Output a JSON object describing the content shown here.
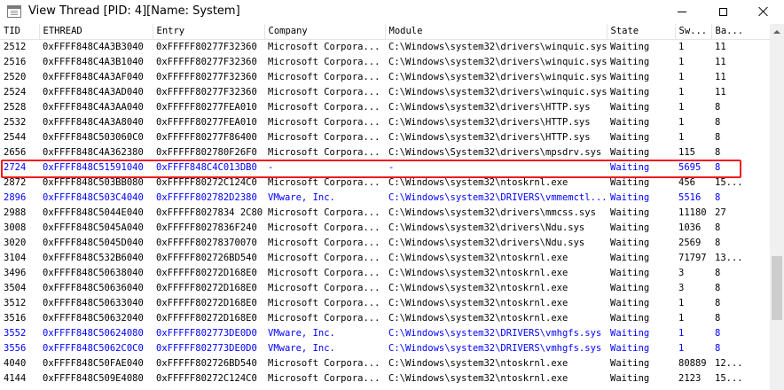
{
  "window": {
    "title": "View Thread [PID: 4][Name: System]"
  },
  "icons": {
    "app": "window-list-icon",
    "minimize": "minimize-icon",
    "maximize": "maximize-icon",
    "close": "close-icon",
    "scroll_up": "arrow-up-icon"
  },
  "colors": {
    "highlight_text": "#0000ff",
    "annotation_box": "#ee1c1c"
  },
  "table": {
    "columns": [
      "TID",
      "ETHREAD",
      "Entry",
      "Company",
      "Module",
      "State",
      "Sw...",
      "Ba..."
    ],
    "rows": [
      {
        "tid": "2512",
        "ethread": "0xFFFF848C4A3B3040",
        "entry": "0xFFFFF80277F32360",
        "company": "Microsoft Corpora...",
        "module": "C:\\Windows\\system32\\drivers\\winquic.sys",
        "state": "Waiting",
        "sw": "1",
        "ba": "11",
        "hl": false
      },
      {
        "tid": "2516",
        "ethread": "0xFFFF848C4A3B1040",
        "entry": "0xFFFFF80277F32360",
        "company": "Microsoft Corpora...",
        "module": "C:\\Windows\\system32\\drivers\\winquic.sys",
        "state": "Waiting",
        "sw": "1",
        "ba": "11",
        "hl": false
      },
      {
        "tid": "2520",
        "ethread": "0xFFFF848C4A3AF040",
        "entry": "0xFFFFF80277F32360",
        "company": "Microsoft Corpora...",
        "module": "C:\\Windows\\system32\\drivers\\winquic.sys",
        "state": "Waiting",
        "sw": "1",
        "ba": "11",
        "hl": false
      },
      {
        "tid": "2524",
        "ethread": "0xFFFF848C4A3AD040",
        "entry": "0xFFFFF80277F32360",
        "company": "Microsoft Corpora...",
        "module": "C:\\Windows\\system32\\drivers\\winquic.sys",
        "state": "Waiting",
        "sw": "1",
        "ba": "11",
        "hl": false
      },
      {
        "tid": "2528",
        "ethread": "0xFFFF848C4A3AA040",
        "entry": "0xFFFFF80277FEA010",
        "company": "Microsoft Corpora...",
        "module": "C:\\Windows\\system32\\drivers\\HTTP.sys",
        "state": "Waiting",
        "sw": "1",
        "ba": "8",
        "hl": false
      },
      {
        "tid": "2532",
        "ethread": "0xFFFF848C4A3A8040",
        "entry": "0xFFFFF80277FEA010",
        "company": "Microsoft Corpora...",
        "module": "C:\\Windows\\system32\\drivers\\HTTP.sys",
        "state": "Waiting",
        "sw": "1",
        "ba": "8",
        "hl": false
      },
      {
        "tid": "2544",
        "ethread": "0xFFFF848C503060C0",
        "entry": "0xFFFFF80277F86400",
        "company": "Microsoft Corpora...",
        "module": "C:\\Windows\\system32\\drivers\\HTTP.sys",
        "state": "Waiting",
        "sw": "1",
        "ba": "8",
        "hl": false
      },
      {
        "tid": "2656",
        "ethread": "0xFFFF848C4A362380",
        "entry": "0xFFFFF802780F26F0",
        "company": "Microsoft Corpora...",
        "module": "C:\\Windows\\System32\\drivers\\mpsdrv.sys",
        "state": "Waiting",
        "sw": "115",
        "ba": "8",
        "hl": false
      },
      {
        "tid": "2724",
        "ethread": "0xFFFF848C51591040",
        "entry": "0xFFFF848C4C013DB0",
        "company": "-",
        "module": "-",
        "state": "Waiting",
        "sw": "5695",
        "ba": "8",
        "hl": true
      },
      {
        "tid": "2872",
        "ethread": "0xFFFF848C503BB080",
        "entry": "0xFFFFF80272C124C0",
        "company": "Microsoft Corpora...",
        "module": "C:\\Windows\\system32\\ntoskrnl.exe",
        "state": "Waiting",
        "sw": "456",
        "ba": "15...",
        "hl": false
      },
      {
        "tid": "2896",
        "ethread": "0xFFFF848C503C4040",
        "entry": "0xFFFFF802782D2380",
        "company": "VMware, Inc.",
        "module": "C:\\Windows\\system32\\DRIVERS\\vmmemctl...",
        "state": "Waiting",
        "sw": "5516",
        "ba": "8",
        "hl": true
      },
      {
        "tid": "2988",
        "ethread": "0xFFFF848C5044E040",
        "entry": "0xFFFFF8027834 2C80",
        "company": "Microsoft Corpora...",
        "module": "C:\\Windows\\system32\\drivers\\mmcss.sys",
        "state": "Waiting",
        "sw": "11180",
        "ba": "27",
        "hl": false
      },
      {
        "tid": "3008",
        "ethread": "0xFFFF848C5045A040",
        "entry": "0xFFFFF8027836F240",
        "company": "Microsoft Corpora...",
        "module": "C:\\Windows\\system32\\drivers\\Ndu.sys",
        "state": "Waiting",
        "sw": "1036",
        "ba": "8",
        "hl": false
      },
      {
        "tid": "3020",
        "ethread": "0xFFFF848C5045D040",
        "entry": "0xFFFFF80278370070",
        "company": "Microsoft Corpora...",
        "module": "C:\\Windows\\system32\\drivers\\Ndu.sys",
        "state": "Waiting",
        "sw": "2569",
        "ba": "8",
        "hl": false
      },
      {
        "tid": "3104",
        "ethread": "0xFFFF848C532B6040",
        "entry": "0xFFFFF802726BD540",
        "company": "Microsoft Corpora...",
        "module": "C:\\Windows\\system32\\ntoskrnl.exe",
        "state": "Waiting",
        "sw": "71797",
        "ba": "13...",
        "hl": false
      },
      {
        "tid": "3496",
        "ethread": "0xFFFF848C50638040",
        "entry": "0xFFFFF80272D168E0",
        "company": "Microsoft Corpora...",
        "module": "C:\\Windows\\system32\\ntoskrnl.exe",
        "state": "Waiting",
        "sw": "3",
        "ba": "8",
        "hl": false
      },
      {
        "tid": "3504",
        "ethread": "0xFFFF848C50636040",
        "entry": "0xFFFFF80272D168E0",
        "company": "Microsoft Corpora...",
        "module": "C:\\Windows\\system32\\ntoskrnl.exe",
        "state": "Waiting",
        "sw": "3",
        "ba": "8",
        "hl": false
      },
      {
        "tid": "3512",
        "ethread": "0xFFFF848C50633040",
        "entry": "0xFFFFF80272D168E0",
        "company": "Microsoft Corpora...",
        "module": "C:\\Windows\\system32\\ntoskrnl.exe",
        "state": "Waiting",
        "sw": "1",
        "ba": "8",
        "hl": false
      },
      {
        "tid": "3516",
        "ethread": "0xFFFF848C50632040",
        "entry": "0xFFFFF80272D168E0",
        "company": "Microsoft Corpora...",
        "module": "C:\\Windows\\system32\\ntoskrnl.exe",
        "state": "Waiting",
        "sw": "1",
        "ba": "8",
        "hl": false
      },
      {
        "tid": "3552",
        "ethread": "0xFFFF848C50624080",
        "entry": "0xFFFFF802773DE0D0",
        "company": "VMware, Inc.",
        "module": "C:\\Windows\\system32\\DRIVERS\\vmhgfs.sys",
        "state": "Waiting",
        "sw": "1",
        "ba": "8",
        "hl": true
      },
      {
        "tid": "3556",
        "ethread": "0xFFFF848C5062C0C0",
        "entry": "0xFFFFF802773DE0D0",
        "company": "VMware, Inc.",
        "module": "C:\\Windows\\system32\\DRIVERS\\vmhgfs.sys",
        "state": "Waiting",
        "sw": "1",
        "ba": "8",
        "hl": true
      },
      {
        "tid": "4040",
        "ethread": "0xFFFF848C50FAE040",
        "entry": "0xFFFFF802726BD540",
        "company": "Microsoft Corpora...",
        "module": "C:\\Windows\\system32\\ntoskrnl.exe",
        "state": "Waiting",
        "sw": "80889",
        "ba": "12...",
        "hl": false
      },
      {
        "tid": "4144",
        "ethread": "0xFFFF848C509E4080",
        "entry": "0xFFFFF80272C124C0",
        "company": "Microsoft Corpora...",
        "module": "C:\\Windows\\system32\\ntoskrnl.exe",
        "state": "Waiting",
        "sw": "2123",
        "ba": "15...",
        "hl": false
      }
    ]
  }
}
